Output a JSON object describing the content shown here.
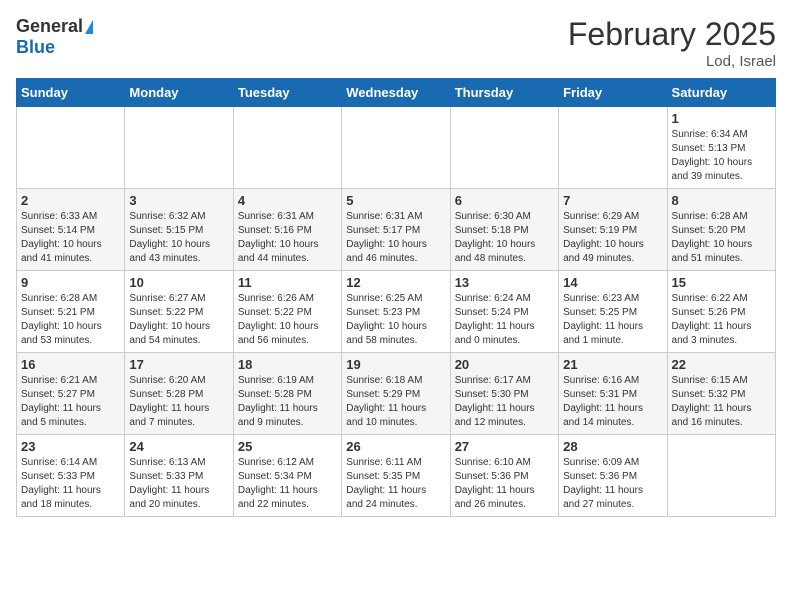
{
  "header": {
    "logo_general": "General",
    "logo_blue": "Blue",
    "month": "February 2025",
    "location": "Lod, Israel"
  },
  "weekdays": [
    "Sunday",
    "Monday",
    "Tuesday",
    "Wednesday",
    "Thursday",
    "Friday",
    "Saturday"
  ],
  "weeks": [
    [
      {
        "day": "",
        "info": ""
      },
      {
        "day": "",
        "info": ""
      },
      {
        "day": "",
        "info": ""
      },
      {
        "day": "",
        "info": ""
      },
      {
        "day": "",
        "info": ""
      },
      {
        "day": "",
        "info": ""
      },
      {
        "day": "1",
        "info": "Sunrise: 6:34 AM\nSunset: 5:13 PM\nDaylight: 10 hours\nand 39 minutes."
      }
    ],
    [
      {
        "day": "2",
        "info": "Sunrise: 6:33 AM\nSunset: 5:14 PM\nDaylight: 10 hours\nand 41 minutes."
      },
      {
        "day": "3",
        "info": "Sunrise: 6:32 AM\nSunset: 5:15 PM\nDaylight: 10 hours\nand 43 minutes."
      },
      {
        "day": "4",
        "info": "Sunrise: 6:31 AM\nSunset: 5:16 PM\nDaylight: 10 hours\nand 44 minutes."
      },
      {
        "day": "5",
        "info": "Sunrise: 6:31 AM\nSunset: 5:17 PM\nDaylight: 10 hours\nand 46 minutes."
      },
      {
        "day": "6",
        "info": "Sunrise: 6:30 AM\nSunset: 5:18 PM\nDaylight: 10 hours\nand 48 minutes."
      },
      {
        "day": "7",
        "info": "Sunrise: 6:29 AM\nSunset: 5:19 PM\nDaylight: 10 hours\nand 49 minutes."
      },
      {
        "day": "8",
        "info": "Sunrise: 6:28 AM\nSunset: 5:20 PM\nDaylight: 10 hours\nand 51 minutes."
      }
    ],
    [
      {
        "day": "9",
        "info": "Sunrise: 6:28 AM\nSunset: 5:21 PM\nDaylight: 10 hours\nand 53 minutes."
      },
      {
        "day": "10",
        "info": "Sunrise: 6:27 AM\nSunset: 5:22 PM\nDaylight: 10 hours\nand 54 minutes."
      },
      {
        "day": "11",
        "info": "Sunrise: 6:26 AM\nSunset: 5:22 PM\nDaylight: 10 hours\nand 56 minutes."
      },
      {
        "day": "12",
        "info": "Sunrise: 6:25 AM\nSunset: 5:23 PM\nDaylight: 10 hours\nand 58 minutes."
      },
      {
        "day": "13",
        "info": "Sunrise: 6:24 AM\nSunset: 5:24 PM\nDaylight: 11 hours\nand 0 minutes."
      },
      {
        "day": "14",
        "info": "Sunrise: 6:23 AM\nSunset: 5:25 PM\nDaylight: 11 hours\nand 1 minute."
      },
      {
        "day": "15",
        "info": "Sunrise: 6:22 AM\nSunset: 5:26 PM\nDaylight: 11 hours\nand 3 minutes."
      }
    ],
    [
      {
        "day": "16",
        "info": "Sunrise: 6:21 AM\nSunset: 5:27 PM\nDaylight: 11 hours\nand 5 minutes."
      },
      {
        "day": "17",
        "info": "Sunrise: 6:20 AM\nSunset: 5:28 PM\nDaylight: 11 hours\nand 7 minutes."
      },
      {
        "day": "18",
        "info": "Sunrise: 6:19 AM\nSunset: 5:28 PM\nDaylight: 11 hours\nand 9 minutes."
      },
      {
        "day": "19",
        "info": "Sunrise: 6:18 AM\nSunset: 5:29 PM\nDaylight: 11 hours\nand 10 minutes."
      },
      {
        "day": "20",
        "info": "Sunrise: 6:17 AM\nSunset: 5:30 PM\nDaylight: 11 hours\nand 12 minutes."
      },
      {
        "day": "21",
        "info": "Sunrise: 6:16 AM\nSunset: 5:31 PM\nDaylight: 11 hours\nand 14 minutes."
      },
      {
        "day": "22",
        "info": "Sunrise: 6:15 AM\nSunset: 5:32 PM\nDaylight: 11 hours\nand 16 minutes."
      }
    ],
    [
      {
        "day": "23",
        "info": "Sunrise: 6:14 AM\nSunset: 5:33 PM\nDaylight: 11 hours\nand 18 minutes."
      },
      {
        "day": "24",
        "info": "Sunrise: 6:13 AM\nSunset: 5:33 PM\nDaylight: 11 hours\nand 20 minutes."
      },
      {
        "day": "25",
        "info": "Sunrise: 6:12 AM\nSunset: 5:34 PM\nDaylight: 11 hours\nand 22 minutes."
      },
      {
        "day": "26",
        "info": "Sunrise: 6:11 AM\nSunset: 5:35 PM\nDaylight: 11 hours\nand 24 minutes."
      },
      {
        "day": "27",
        "info": "Sunrise: 6:10 AM\nSunset: 5:36 PM\nDaylight: 11 hours\nand 26 minutes."
      },
      {
        "day": "28",
        "info": "Sunrise: 6:09 AM\nSunset: 5:36 PM\nDaylight: 11 hours\nand 27 minutes."
      },
      {
        "day": "",
        "info": ""
      }
    ]
  ]
}
